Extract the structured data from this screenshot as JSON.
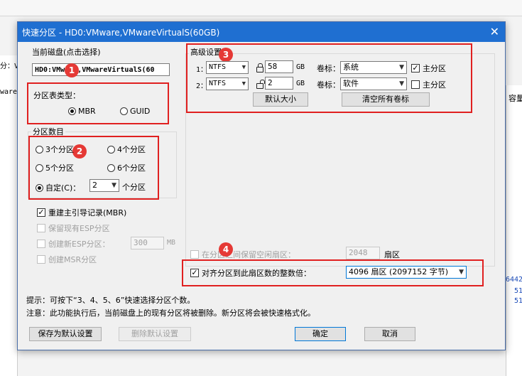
{
  "background": {
    "left_snippet_1": "分：VM",
    "left_snippet_2": "ware",
    "right_header": "容量",
    "right_nums": [
      "6442",
      "51",
      "51"
    ]
  },
  "dialog": {
    "title": "快速分区 - HD0:VMware,VMwareVirtualS(60GB)",
    "close_glyph": "✕",
    "current_disk": {
      "label": "当前磁盘(点击选择)",
      "value": "HD0:VMware,VMwareVirtualS(60"
    },
    "partition_table": {
      "label": "分区表类型：",
      "options": [
        "MBR",
        "GUID"
      ],
      "selected": "MBR"
    },
    "partition_count": {
      "label": "分区数目",
      "options": [
        "3个分区",
        "4个分区",
        "5个分区",
        "6个分区"
      ],
      "custom_label": "自定(C)：",
      "custom_value": "2",
      "custom_suffix": "个分区"
    },
    "options": {
      "rebuild_mbr": "重建主引导记录(MBR)",
      "keep_esp": "保留现有ESP分区",
      "create_esp": "创建新ESP分区：",
      "esp_size": "300",
      "esp_unit": "MB",
      "create_msr": "创建MSR分区"
    },
    "advanced": {
      "label": "高级设置",
      "rows": [
        {
          "num": "1：",
          "fs": "NTFS",
          "size": "58",
          "unit": "GB",
          "vol_label_text": "卷标：",
          "vol_label": "系统",
          "primary_label": "主分区",
          "primary_checked": true
        },
        {
          "num": "2：",
          "fs": "NTFS",
          "size": "2",
          "unit": "GB",
          "vol_label_text": "卷标：",
          "vol_label": "软件",
          "primary_label": "主分区",
          "primary_checked": false
        }
      ],
      "default_size_button": "默认大小",
      "clear_labels_button": "清空所有卷标"
    },
    "reserve": {
      "label": "在分区之间保留空闲扇区：",
      "value": "2048",
      "unit": "扇区"
    },
    "align": {
      "label": "对齐分区到此扇区数的整数倍：",
      "value": "4096 扇区 (2097152 字节)"
    },
    "hints": {
      "tip": "提示：可按下“3、4、5、6”快速选择分区个数。",
      "note": "注意：此功能执行后，当前磁盘上的现有分区将被删除。新分区将会被快速格式化。"
    },
    "buttons": {
      "save_default": "保存为默认设置",
      "delete_default": "删除默认设置",
      "ok": "确定",
      "cancel": "取消"
    },
    "badges": [
      "1",
      "2",
      "3",
      "4"
    ]
  },
  "colors": {
    "titlebar": "#1f6fd1",
    "annotation_red": "#e02020",
    "badge_red": "#e53935"
  }
}
